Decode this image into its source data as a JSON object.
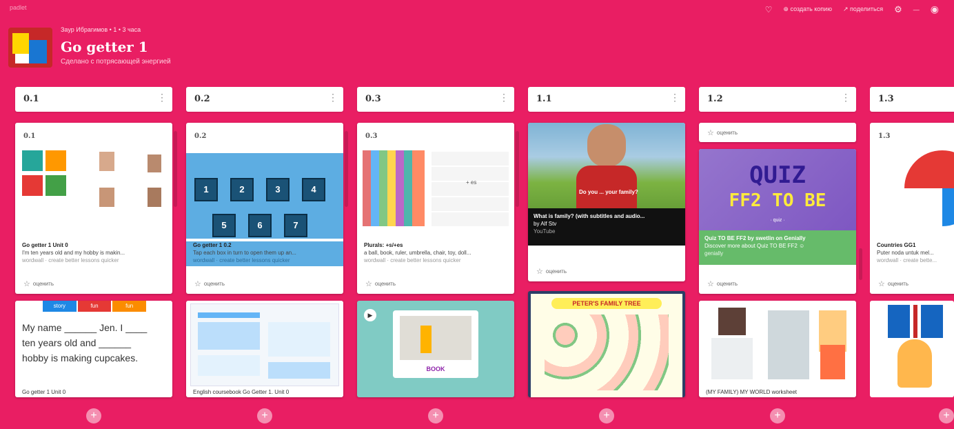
{
  "topbar": {
    "brand": "padlet",
    "actions": [
      "♡",
      "⊕ создать копию",
      "↗ поделиться",
      "⚙",
      "—",
      "◉"
    ]
  },
  "board": {
    "author_line": "Заур Ибрагимов • 1 • 3 часа",
    "title": "Go getter 1",
    "subtitle": "Сделано с потрясающей энергией"
  },
  "columns": [
    {
      "title": "0.1"
    },
    {
      "title": "0.2"
    },
    {
      "title": "0.3"
    },
    {
      "title": "1.1"
    },
    {
      "title": "1.2"
    },
    {
      "title": "1.3"
    }
  ],
  "cards": {
    "c01": {
      "label": "0.1",
      "title": "Go getter 1 Unit 0",
      "desc": "I'm ten years old and my hobby is makin...",
      "source": "wordwall · create better lessons quicker",
      "rate": "оценить"
    },
    "c02": {
      "label": "0.2",
      "tiles": [
        "1",
        "2",
        "3",
        "4",
        "5",
        "6",
        "7"
      ],
      "title": "Go getter 1 0.2",
      "desc": "Tap each box in turn to open them up an...",
      "source": "wordwall · create better lessons quicker",
      "rate": "оценить"
    },
    "c03": {
      "label": "0.3",
      "title": "Plurals: +s/+es",
      "desc": "a ball, book, ruler, umbrella, chair, toy, doll...",
      "source": "wordwall · create better lessons quicker",
      "rate": "оценить",
      "center_text": "+ es"
    },
    "c11": {
      "overlay": "Do you ... your family?",
      "title": "What is family? (with subtitles and audio...",
      "author": "by Alf Stv",
      "source": "YouTube",
      "rate": "оценить"
    },
    "c12_rate_top": "оценить",
    "c12": {
      "quiz1": "QUIZ",
      "quiz2": "FF2 TO BE",
      "quiz_small": "· quiz ·",
      "title": "Quiz TO BE FF2 by swetlin on Genially",
      "desc": "Discover more about Quiz TO BE FF2 ☺",
      "source": "genially",
      "rate": "оценить"
    },
    "c13": {
      "label": "1.3",
      "title": "Countries GG1",
      "desc": "Puter noda untuk mel...",
      "source": "wordwall · create bette...",
      "rate": "оценить"
    },
    "c01b": {
      "tabs": [
        "story",
        "fun",
        "fun"
      ],
      "line1": "My name ______ Jen. I ____",
      "line2": "ten years old and ______",
      "line3": "hobby is making cupcakes.",
      "caption": "Go getter 1 Unit 0"
    },
    "c02b": {
      "caption": "English coursebook Go Getter 1. Unit 0"
    },
    "c03b": {
      "word": "BOOK"
    },
    "c11b": {
      "poster": "PETER'S FAMILY TREE"
    },
    "c12b": {
      "caption": "(MY FAMILY) MY WORLD worksheet"
    }
  },
  "add_buttons": [
    "+",
    "+",
    "+",
    "+",
    "+",
    "+"
  ],
  "colors": {
    "background": "#e91e63",
    "card": "#ffffff",
    "genially_green": "#66bb6a",
    "quiz_purple": "#7e57c2",
    "quiz_yellow": "#ffeb3b"
  }
}
